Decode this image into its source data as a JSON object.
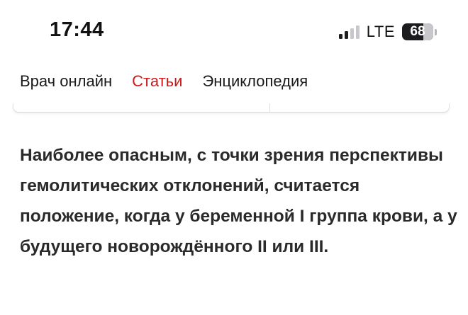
{
  "status_bar": {
    "time": "17:44",
    "network": "LTE",
    "battery_level": "68",
    "battery_fraction": 0.68,
    "signal_bars_active": 2,
    "signal_bars_total": 4
  },
  "nav": {
    "items": [
      {
        "label": "Врач онлайн",
        "active": false
      },
      {
        "label": "Статьи",
        "active": true
      },
      {
        "label": "Энциклопедия",
        "active": false
      }
    ]
  },
  "colors": {
    "accent": "#cc1a1a",
    "text": "#2a2a2a",
    "signal_active": "#1c1c1e",
    "signal_inactive": "#c8c8cc"
  },
  "article": {
    "paragraph": "Наиболее опасным, с точки зрения перспективы гемолитических отклонений, считается положение, когда у беременной I группа крови, а у будущего новорождённого II или III."
  }
}
